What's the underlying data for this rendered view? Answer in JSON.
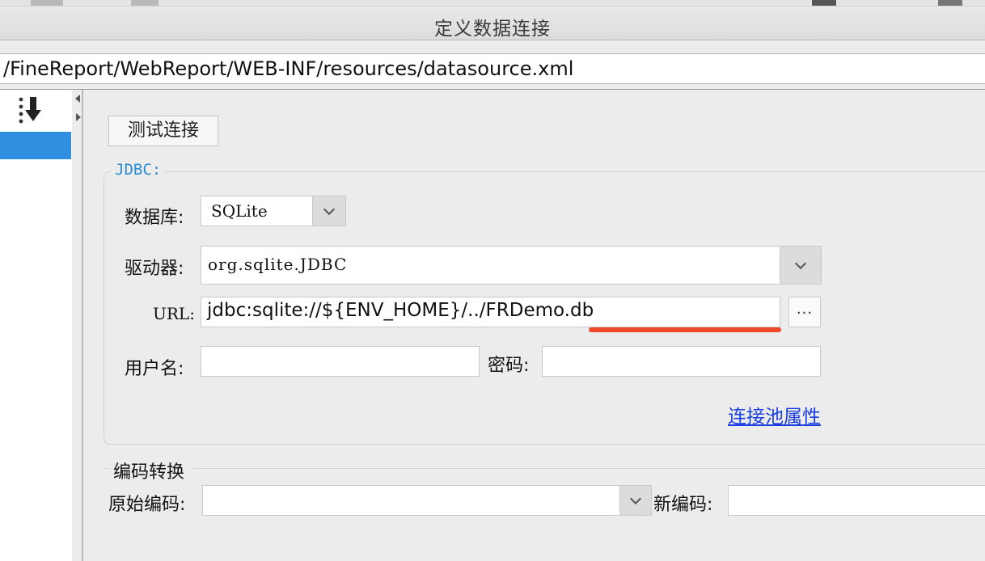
{
  "window": {
    "title": "定义数据连接",
    "path": "/FineReport/WebReport/WEB-INF/resources/datasource.xml"
  },
  "toolbar": {
    "test_connection_label": "测试连接"
  },
  "jdbc": {
    "legend": "JDBC:",
    "database_label": "数据库:",
    "database_value": "SQLite",
    "driver_label": "驱动器:",
    "driver_value": "org.sqlite.JDBC",
    "url_label": "URL:",
    "url_value": "jdbc:sqlite://${ENV_HOME}/../FRDemo.db",
    "browse_label": "...",
    "username_label": "用户名:",
    "username_value": "",
    "password_label": "密码:",
    "password_value": "",
    "pool_link": "连接池属性"
  },
  "encoding": {
    "legend": "编码转换",
    "original_label": "原始编码:",
    "original_value": "",
    "new_label": "新编码:",
    "new_value": ""
  },
  "colors": {
    "selection": "#2f8fe0",
    "legend_text": "#2b8cd0",
    "link": "#1a3ee0",
    "annotation_underline": "#ee4a2a"
  },
  "icons": {
    "sort": "sort-descending-icon",
    "collapse_left": "triangle-left-icon",
    "collapse_right": "triangle-right-icon",
    "dropdown": "chevron-down-icon"
  }
}
